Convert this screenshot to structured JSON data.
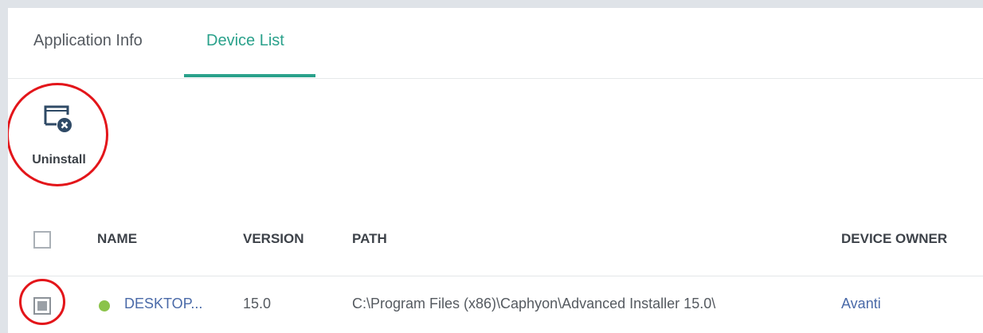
{
  "tabs": [
    {
      "label": "Application Info",
      "active": false
    },
    {
      "label": "Device List",
      "active": true
    }
  ],
  "toolbar": {
    "uninstall_label": "Uninstall",
    "uninstall_icon": "window-remove-icon"
  },
  "table": {
    "columns": [
      "NAME",
      "VERSION",
      "PATH",
      "DEVICE OWNER"
    ],
    "rows": [
      {
        "checked": true,
        "status": "online",
        "name": "DESKTOP...",
        "version": "15.0",
        "path": "C:\\Program Files (x86)\\Caphyon\\Advanced Installer 15.0\\",
        "owner": "Avanti"
      }
    ]
  },
  "colors": {
    "accent": "#2aa18b",
    "link": "#4a6aa8",
    "status_online": "#8bc34a",
    "callout": "#e3151a"
  }
}
